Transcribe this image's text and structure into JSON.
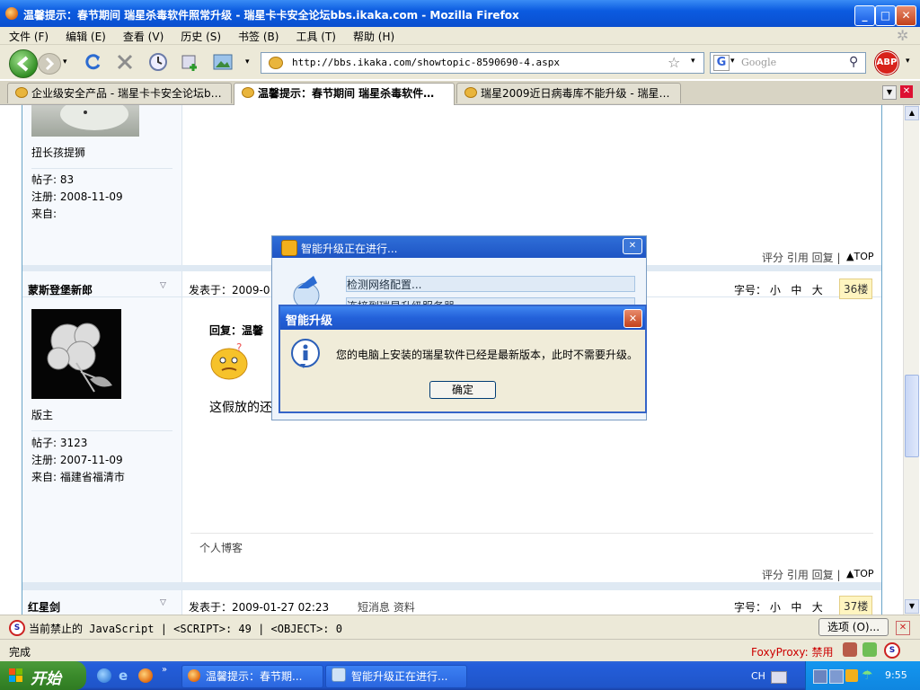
{
  "window": {
    "title": "温馨提示：春节期间 瑞星杀毒软件照常升级 - 瑞星卡卡安全论坛bbs.ikaka.com - Mozilla Firefox",
    "minimize": "_",
    "maximize": "□",
    "close": "✕"
  },
  "menu": [
    "文件 (F)",
    "编辑 (E)",
    "查看 (V)",
    "历史 (S)",
    "书签 (B)",
    "工具 (T)",
    "帮助 (H)"
  ],
  "toolbar": {
    "url": "http://bbs.ikaka.com/showtopic-8590690-4.aspx",
    "search_placeholder": "Google",
    "abp": "ABP"
  },
  "tabs": [
    {
      "label": "企业级安全产品 - 瑞星卡卡安全论坛b…",
      "active": false
    },
    {
      "label": "温馨提示：春节期间 瑞星杀毒软件…",
      "active": true
    },
    {
      "label": "瑞星2009近日病毒库不能升级 - 瑞星…",
      "active": false
    }
  ],
  "posts": [
    {
      "user_title": "扭长孩提狮",
      "posts_label": "帖子:",
      "posts": "83",
      "reg_label": "注册:",
      "reg": "2008-11-09",
      "from_label": "来自:",
      "from": "",
      "actions": "评分 引用 回复 |",
      "top": "TOP"
    },
    {
      "username": "蒙斯登堡新郎",
      "posted_label": "发表于：",
      "posted": "2009-0",
      "font_label": "字号：",
      "font_sizes": [
        "小",
        "中",
        "大"
      ],
      "floor": "36楼",
      "user_title": "版主",
      "posts_label": "帖子:",
      "posts": "3123",
      "reg_label": "注册:",
      "reg": "2007-11-09",
      "from_label": "来自:",
      "from": "福建省福清市",
      "reply_title": "回复：温馨",
      "body": "这假放的还",
      "blog": "个人博客",
      "actions": "评分 引用 回复 |",
      "top": "TOP"
    },
    {
      "username": "红星剑",
      "posted_label": "发表于：",
      "posted": "2009-01-27 02:23",
      "links": "短消息 资料",
      "font_label": "字号：",
      "font_sizes": [
        "小",
        "中",
        "大"
      ],
      "floor": "37楼"
    }
  ],
  "dialog_progress": {
    "title": "智能升级正在进行...",
    "steps": [
      "检测网络配置...",
      "连接到瑞星升级服务器"
    ],
    "close": "✕"
  },
  "dialog_info": {
    "title": "智能升级",
    "message": "您的电脑上安装的瑞星软件已经是最新版本，此时不需要升级。",
    "ok": "确定",
    "close": "✕"
  },
  "jsbar": {
    "text": "当前禁止的 JavaScript | <SCRIPT>: 49 | <OBJECT>: 0",
    "options": "选项 (O)..."
  },
  "status": {
    "text": "完成",
    "foxyproxy": "FoxyProxy: 禁用"
  },
  "taskbar": {
    "start": "开始",
    "tasks": [
      "温馨提示：春节期...",
      "智能升级正在进行..."
    ],
    "ime": "CH",
    "clock": "9:55"
  },
  "colors": {
    "accent": "#0a4fcf",
    "link": "#222222",
    "floor_badge": "#fff5c0"
  }
}
